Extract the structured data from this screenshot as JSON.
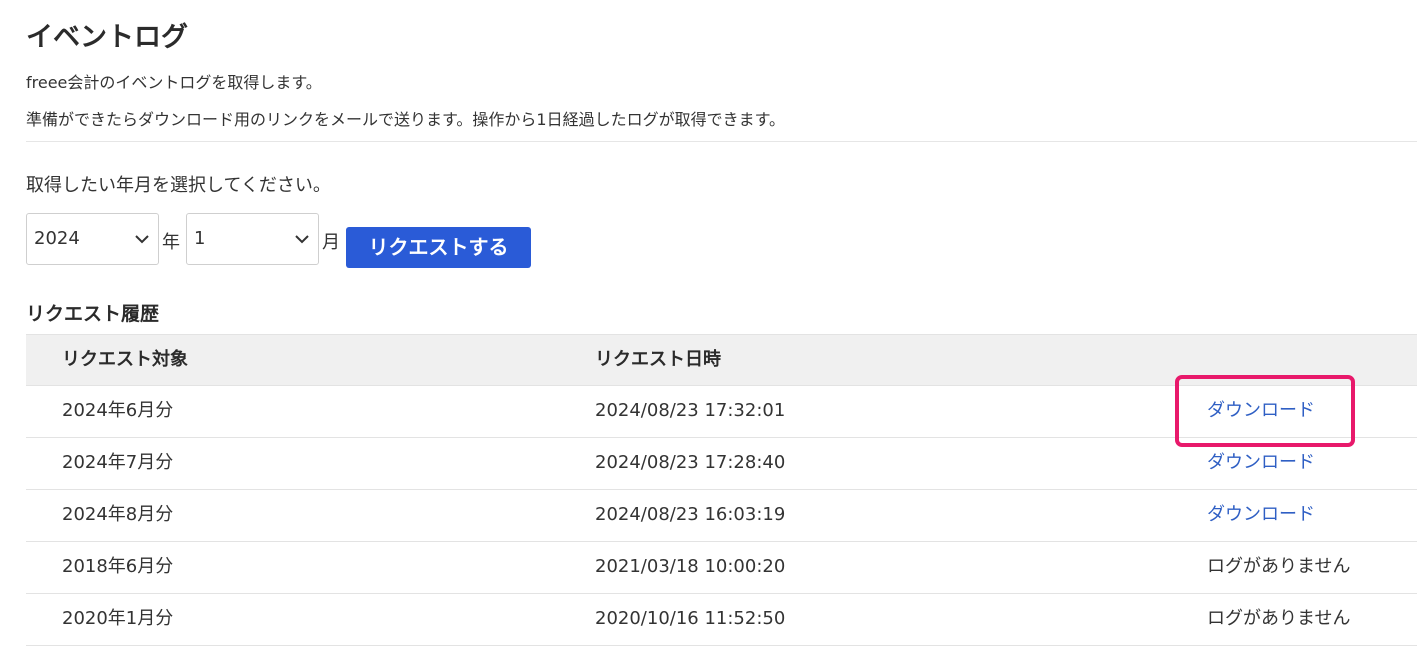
{
  "page": {
    "title": "イベントログ",
    "description_1": "freee会計のイベントログを取得します。",
    "description_2": "準備ができたらダウンロード用のリンクをメールで送ります。操作から1日経過したログが取得できます。"
  },
  "form": {
    "prompt": "取得したい年月を選択してください。",
    "year_value": "2024",
    "year_unit": "年",
    "month_value": "1",
    "month_unit": "月",
    "request_button_label": "リクエストする"
  },
  "history": {
    "title": "リクエスト履歴",
    "columns": {
      "target": "リクエスト対象",
      "date": "リクエスト日時"
    },
    "rows": [
      {
        "target": "2024年6月分",
        "date": "2024/08/23 17:32:01",
        "action": "ダウンロード",
        "link": true
      },
      {
        "target": "2024年7月分",
        "date": "2024/08/23 17:28:40",
        "action": "ダウンロード",
        "link": true
      },
      {
        "target": "2024年8月分",
        "date": "2024/08/23 16:03:19",
        "action": "ダウンロード",
        "link": true
      },
      {
        "target": "2018年6月分",
        "date": "2021/03/18 10:00:20",
        "action": "ログがありません",
        "link": false
      },
      {
        "target": "2020年1月分",
        "date": "2020/10/16 11:52:50",
        "action": "ログがありません",
        "link": false
      }
    ]
  },
  "colors": {
    "accent": "#2a5bd7",
    "link": "#2f5fc4",
    "highlight": "#e8196b",
    "header_bg": "#f0f0f0"
  },
  "icons": {
    "select_chevron": "chevron-down-icon"
  }
}
